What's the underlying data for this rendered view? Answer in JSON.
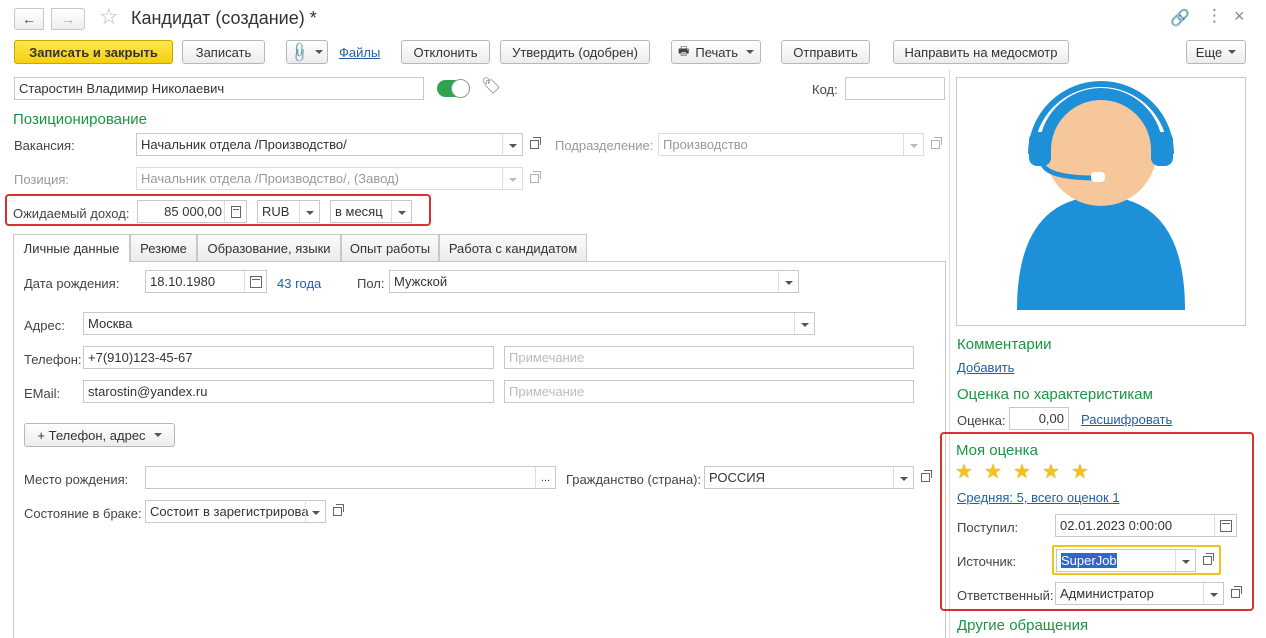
{
  "window": {
    "title": "Кандидат (создание) *"
  },
  "toolbar": {
    "save_close": "Записать и закрыть",
    "save": "Записать",
    "files": "Файлы",
    "reject": "Отклонить",
    "approve": "Утвердить (одобрен)",
    "print": "Печать",
    "send": "Отправить",
    "medical": "Направить на медосмотр",
    "more": "Еще"
  },
  "candidate": {
    "name": "Старостин Владимир Николаевич",
    "code_label": "Код:",
    "code_value": ""
  },
  "positioning": {
    "title": "Позиционирование",
    "vacancy_label": "Вакансия:",
    "vacancy_value": "Начальник отдела /Производство/",
    "division_label": "Подразделение:",
    "division_value": "Производство",
    "position_label": "Позиция:",
    "position_value": "Начальник отдела /Производство/, (Завод)",
    "income_label": "Ожидаемый доход:",
    "income_value": "85 000,00",
    "currency": "RUB",
    "period": "в месяц"
  },
  "tabs": [
    {
      "label": "Личные данные"
    },
    {
      "label": "Резюме"
    },
    {
      "label": "Образование, языки"
    },
    {
      "label": "Опыт работы"
    },
    {
      "label": "Работа с кандидатом"
    }
  ],
  "personal": {
    "birth_label": "Дата рождения:",
    "birth_value": "18.10.1980",
    "age": "43 года",
    "gender_label": "Пол:",
    "gender_value": "Мужской",
    "address_label": "Адрес:",
    "address_value": "Москва",
    "phone_label": "Телефон:",
    "phone_value": "+7(910)123-45-67",
    "phone_note_placeholder": "Примечание",
    "email_label": "EMail:",
    "email_value": "starostin@yandex.ru",
    "email_note_placeholder": "Примечание",
    "add_contact": "+ Телефон, адрес",
    "birthplace_label": "Место рождения:",
    "birthplace_value": "",
    "citizenship_label": "Гражданство (страна):",
    "citizenship_value": "РОССИЯ",
    "marital_label": "Состояние в браке:",
    "marital_value": "Состоит в зарегистрирова"
  },
  "side": {
    "comments_title": "Комментарии",
    "add_link": "Добавить",
    "rating_title": "Оценка по характеристикам",
    "rating_label": "Оценка:",
    "rating_value": "0,00",
    "decode_link": "Расшифровать",
    "my_rating_title": "Моя оценка",
    "stars": 5,
    "average_link": "Средняя: 5, всего оценок 1",
    "received_label": "Поступил:",
    "received_value": "02.01.2023  0:00:00",
    "source_label": "Источник:",
    "source_value": "SuperJob",
    "responsible_label": "Ответственный:",
    "responsible_value": "Администратор",
    "other_title": "Другие обращения"
  },
  "colors": {
    "accent_green": "#1a9641",
    "link_blue": "#1f5fa8",
    "highlight_red": "#d93030",
    "primary_yellow": "#f5cf10",
    "avatar_blue": "#1e90d8"
  }
}
